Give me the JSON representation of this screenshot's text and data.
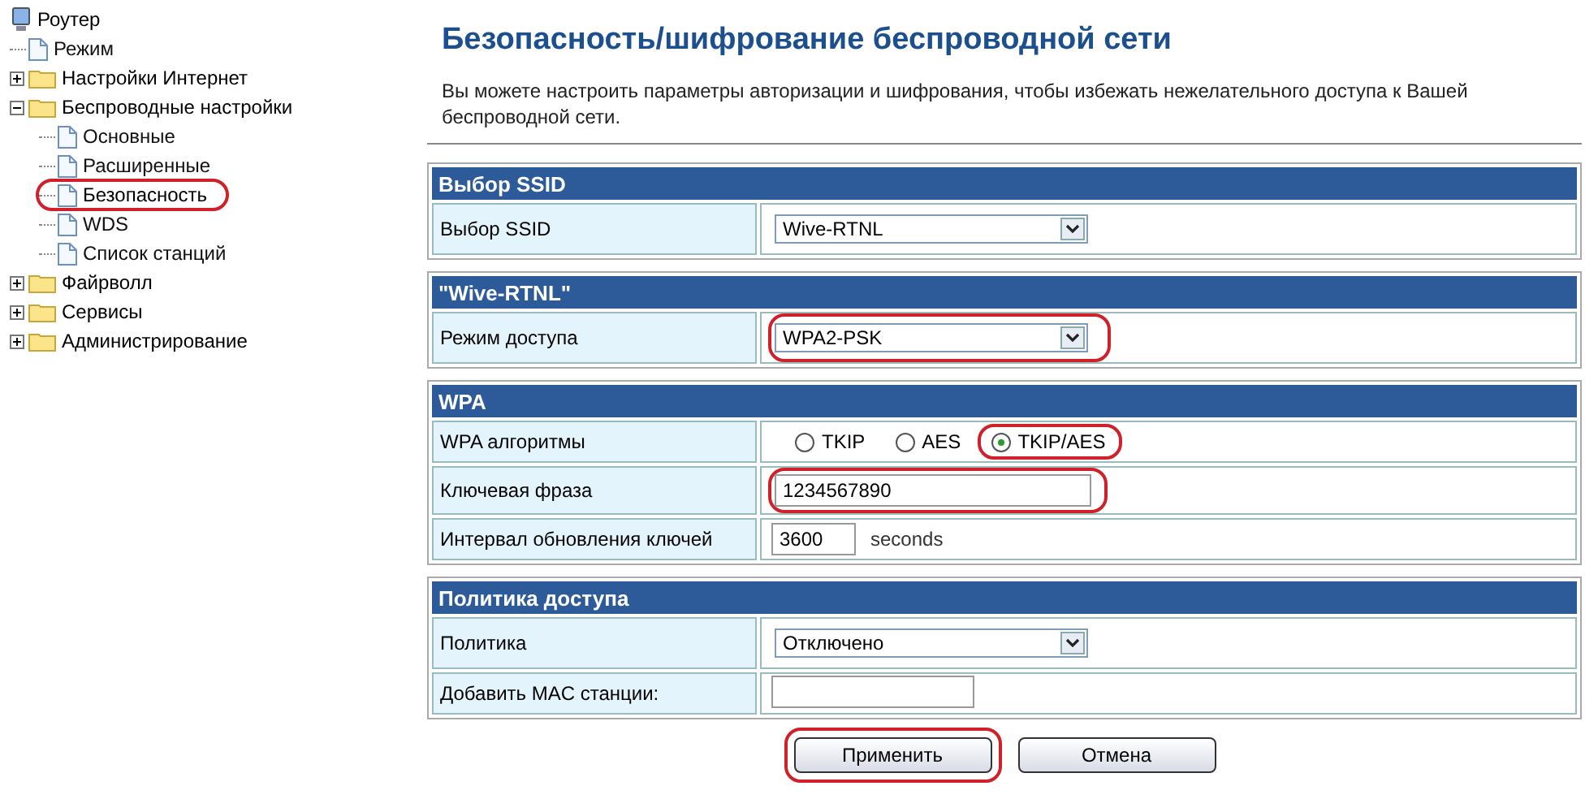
{
  "tree": {
    "label": "Роутер",
    "children": [
      {
        "label": "Режим",
        "kind": "page",
        "selected": false,
        "highlighted": false
      },
      {
        "label": "Настройки Интернет",
        "kind": "folder",
        "expanded": false
      },
      {
        "label": "Беспроводные настройки",
        "kind": "folder",
        "expanded": true,
        "children": [
          {
            "label": "Основные",
            "kind": "page",
            "selected": false,
            "highlighted": false
          },
          {
            "label": "Расширенные",
            "kind": "page",
            "selected": false,
            "highlighted": false
          },
          {
            "label": "Безопасность",
            "kind": "page",
            "selected": true,
            "highlighted": true
          },
          {
            "label": "WDS",
            "kind": "page",
            "selected": false,
            "highlighted": false
          },
          {
            "label": "Список станций",
            "kind": "page",
            "selected": false,
            "highlighted": false
          }
        ]
      },
      {
        "label": "Файрволл",
        "kind": "folder",
        "expanded": false
      },
      {
        "label": "Сервисы",
        "kind": "folder",
        "expanded": false
      },
      {
        "label": "Администрирование",
        "kind": "folder",
        "expanded": false
      }
    ]
  },
  "page": {
    "title": "Безопасность/шифрование беспроводной сети",
    "description": "Вы можете настроить параметры авторизации и шифрования, чтобы избежать нежелательного доступа к Вашей беспроводной сети."
  },
  "sections": [
    {
      "title": "Выбор SSID",
      "rows": [
        {
          "label": "Выбор SSID",
          "kind": "select",
          "value": "Wive-RTNL",
          "highlighted": false
        }
      ]
    },
    {
      "title": "\"Wive-RTNL\"",
      "rows": [
        {
          "label": "Режим доступа",
          "kind": "select",
          "value": "WPA2-PSK",
          "highlighted": true
        }
      ]
    },
    {
      "title": "WPA",
      "rows": [
        {
          "label": "WPA алгоритмы",
          "kind": "radio",
          "options": [
            {
              "label": "TKIP",
              "selected": false,
              "highlighted": false
            },
            {
              "label": "AES",
              "selected": false,
              "highlighted": false
            },
            {
              "label": "TKIP/AES",
              "selected": true,
              "highlighted": true
            }
          ]
        },
        {
          "label": "Ключевая фраза",
          "kind": "text",
          "value": "1234567890",
          "highlighted": true
        },
        {
          "label": "Интервал обновления ключей",
          "kind": "number",
          "value": "3600",
          "unit": "seconds"
        }
      ]
    },
    {
      "title": "Политика доступа",
      "rows": [
        {
          "label": "Политика",
          "kind": "select",
          "value": "Отключено",
          "highlighted": false
        },
        {
          "label": "Добавить MAC станции:",
          "kind": "short_text",
          "value": ""
        }
      ]
    }
  ],
  "buttons": [
    {
      "label": "Применить",
      "highlighted": true
    },
    {
      "label": "Отмена",
      "highlighted": false
    }
  ]
}
